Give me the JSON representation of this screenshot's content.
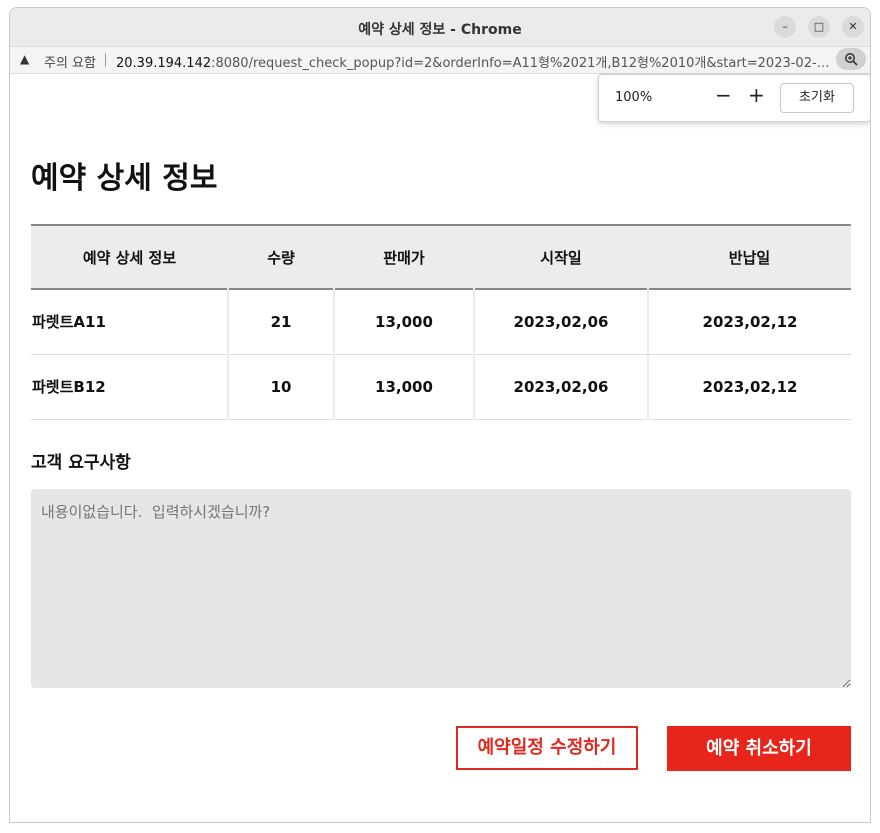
{
  "window": {
    "title": "예약 상세 정보 - Chrome",
    "controls": {
      "minimize": "–",
      "maximize": "□",
      "close": "✕"
    }
  },
  "address_bar": {
    "security_icon": "warning-triangle-icon",
    "security_label": "주의 요함",
    "url_host": "20.39.194.142",
    "url_rest": ":8080/request_check_popup?id=2&orderInfo=A11형%2021개,B12형%2010개&start=2023-02-06&...",
    "zoom_icon": "zoom-magnifier-icon"
  },
  "zoom_popup": {
    "level": "100%",
    "minus": "−",
    "plus": "+",
    "reset_label": "초기화"
  },
  "page": {
    "title": "예약 상세 정보",
    "table": {
      "headers": [
        "예약 상세 정보",
        "수량",
        "판매가",
        "시작일",
        "반납일"
      ],
      "rows": [
        [
          "파렛트A11",
          "21",
          "13,000",
          "2023,02,06",
          "2023,02,12"
        ],
        [
          "파렛트B12",
          "10",
          "13,000",
          "2023,02,06",
          "2023,02,12"
        ]
      ]
    },
    "request_label": "고객 요구사항",
    "request_placeholder": "내용이없습니다.  입력하시겠습니까?",
    "modify_button": "예약일정 수정하기",
    "cancel_button": "예약 취소하기"
  },
  "colors": {
    "accent": "#e8251a",
    "header_bg": "#ececec",
    "textarea_bg": "#e6e6e6"
  }
}
